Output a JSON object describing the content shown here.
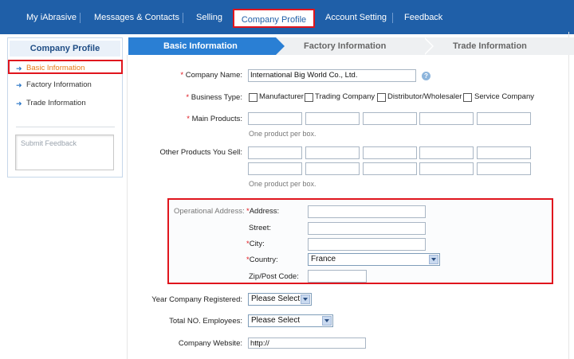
{
  "topnav": {
    "items": [
      "My iAbrasive",
      "Messages & Contacts",
      "Selling",
      "Company Profile",
      "Account Setting",
      "Feedback"
    ]
  },
  "sidebar": {
    "title": "Company Profile",
    "items": [
      {
        "label": "Basic Information"
      },
      {
        "label": "Factory Information"
      },
      {
        "label": "Trade Information"
      }
    ],
    "feedback_placeholder": "Submit Feedback"
  },
  "steps": [
    "Basic Information",
    "Factory Information",
    "Trade Information"
  ],
  "form": {
    "company_name_label": "Company Name:",
    "company_name_value": "International Big World Co., Ltd.",
    "help": "?",
    "business_type_label": "Business Type:",
    "business_types": [
      "Manufacturer",
      "Trading Company",
      "Distributor/Wholesaler",
      "Service Company"
    ],
    "main_products_label": "Main Products:",
    "one_per_box": "One product per box.",
    "other_products_label": "Other Products You Sell:",
    "operational_address_label": "Operational Address:",
    "address_label": "Address:",
    "street_label": "Street:",
    "city_label": "City:",
    "country_label": "Country:",
    "country_value": "France",
    "zip_label": "Zip/Post Code:",
    "year_registered_label": "Year Company Registered:",
    "year_registered_value": "Please Select",
    "employees_label": "Total NO. Employees:",
    "employees_value": "Please Select",
    "website_label": "Company Website:",
    "website_value": "http://",
    "required_mark": "*"
  }
}
